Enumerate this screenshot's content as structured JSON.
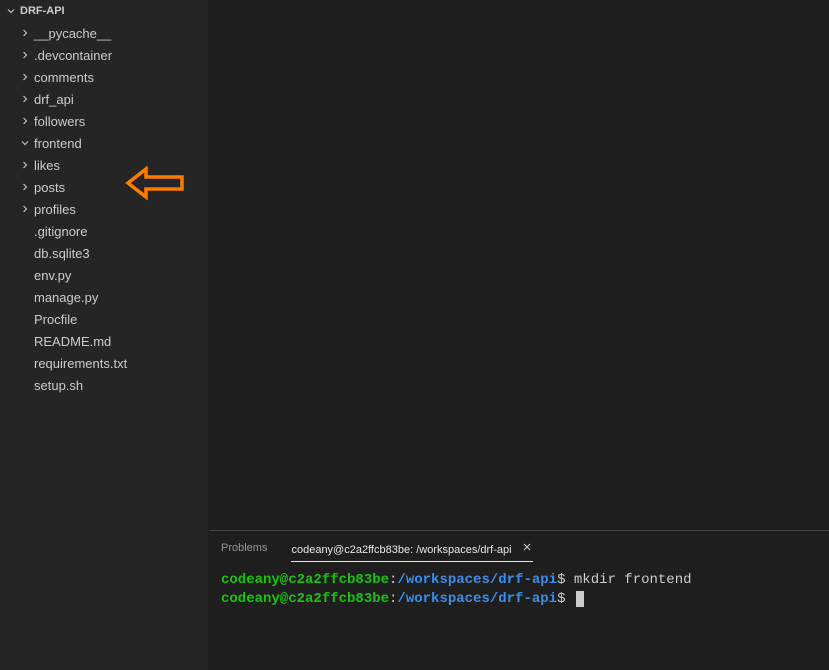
{
  "sidebar": {
    "root": "DRF-API",
    "items": [
      {
        "label": "__pycache__",
        "type": "folder",
        "expanded": false
      },
      {
        "label": ".devcontainer",
        "type": "folder",
        "expanded": false
      },
      {
        "label": "comments",
        "type": "folder",
        "expanded": false
      },
      {
        "label": "drf_api",
        "type": "folder",
        "expanded": false
      },
      {
        "label": "followers",
        "type": "folder",
        "expanded": false
      },
      {
        "label": "frontend",
        "type": "folder",
        "expanded": true
      },
      {
        "label": "likes",
        "type": "folder",
        "expanded": false
      },
      {
        "label": "posts",
        "type": "folder",
        "expanded": false
      },
      {
        "label": "profiles",
        "type": "folder",
        "expanded": false
      },
      {
        "label": ".gitignore",
        "type": "file"
      },
      {
        "label": "db.sqlite3",
        "type": "file"
      },
      {
        "label": "env.py",
        "type": "file"
      },
      {
        "label": "manage.py",
        "type": "file"
      },
      {
        "label": "Procfile",
        "type": "file"
      },
      {
        "label": "README.md",
        "type": "file"
      },
      {
        "label": "requirements.txt",
        "type": "file"
      },
      {
        "label": "setup.sh",
        "type": "file"
      }
    ]
  },
  "panel": {
    "tabs": {
      "problems": "Problems",
      "terminal_title": "codeany@c2a2ffcb83be: /workspaces/drf-api"
    }
  },
  "terminal": {
    "lines": [
      {
        "user": "codeany@c2a2ffcb83be",
        "sep": ":",
        "path": "/workspaces/drf-api",
        "prompt": "$",
        "cmd": " mkdir frontend"
      },
      {
        "user": "codeany@c2a2ffcb83be",
        "sep": ":",
        "path": "/workspaces/drf-api",
        "prompt": "$",
        "cmd": " ",
        "cursor": true
      }
    ]
  },
  "annotation": {
    "color": "#ff7b00"
  }
}
